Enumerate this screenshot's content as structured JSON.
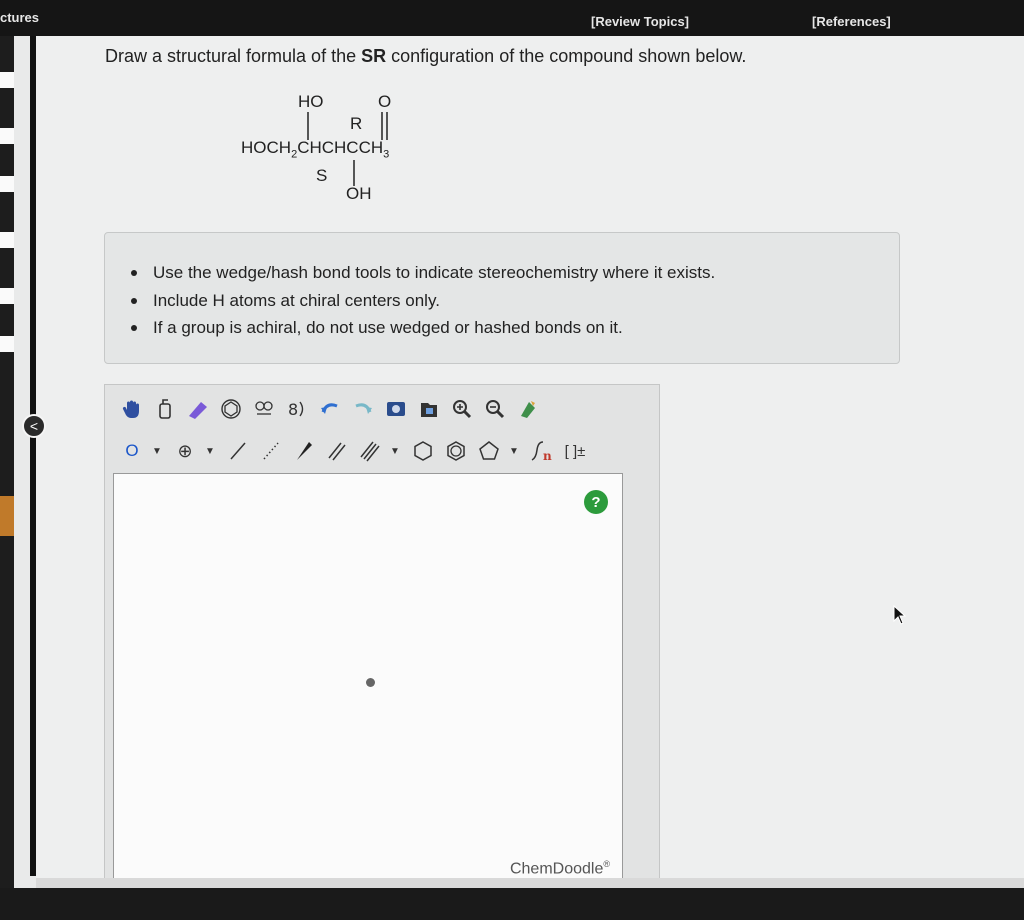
{
  "header": {
    "section_label": "ctures",
    "review_topics": "[Review Topics]",
    "references": "[References]"
  },
  "question": {
    "prefix": "Draw a structural formula of the ",
    "config": "SR",
    "suffix": " configuration of the compound shown below."
  },
  "structure": {
    "top_left": "HO",
    "top_right": "O",
    "label_r": "R",
    "main_chain": "HOCH",
    "sub2": "2",
    "chain_mid": "CHCHCCH",
    "sub3": "3",
    "label_s": "S",
    "bottom": "OH"
  },
  "instructions": [
    "Use the wedge/hash bond tools to indicate stereochemistry where it exists.",
    "Include H atoms at chiral centers only.",
    "If a group is achiral, do not use wedged or hashed bonds on it."
  ],
  "toolbar": {
    "atom_label": "O",
    "charge_label": "⊕",
    "bracket_label": "[ ]±"
  },
  "editor": {
    "help_label": "?",
    "brand": "ChemDoodle",
    "brand_mark": "®"
  },
  "colors": {
    "header_bg": "#151515",
    "help_green": "#2c9b3c",
    "atom_blue": "#1b56c9"
  }
}
